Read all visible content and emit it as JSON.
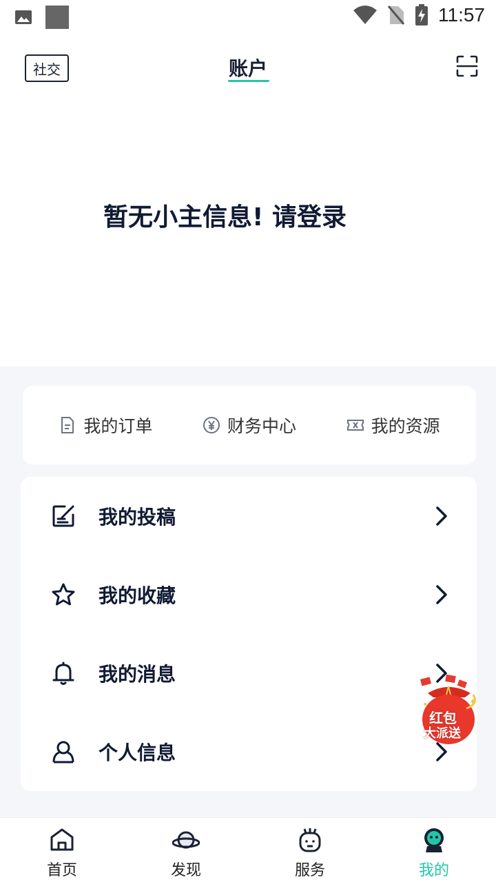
{
  "status_bar": {
    "time": "11:57"
  },
  "header": {
    "social_label": "社交",
    "title": "账户",
    "login_prompt": "暂无小主信息! 请登录"
  },
  "quick_links": [
    {
      "label": "我的订单",
      "icon": "document-icon"
    },
    {
      "label": "财务中心",
      "icon": "yen-coin-icon"
    },
    {
      "label": "我的资源",
      "icon": "ticket-icon"
    }
  ],
  "menu": [
    {
      "label": "我的投稿",
      "icon": "edit-icon"
    },
    {
      "label": "我的收藏",
      "icon": "star-icon"
    },
    {
      "label": "我的消息",
      "icon": "bell-icon"
    },
    {
      "label": "个人信息",
      "icon": "user-icon"
    }
  ],
  "promo": {
    "line1": "红包",
    "line2": "大派送"
  },
  "tabs": [
    {
      "label": "首页",
      "icon": "home-icon"
    },
    {
      "label": "发现",
      "icon": "planet-icon"
    },
    {
      "label": "服务",
      "icon": "robot-icon"
    },
    {
      "label": "我的",
      "icon": "profile-icon",
      "active": true
    }
  ],
  "colors": {
    "accent": "#21c7a8",
    "text_dark": "#101a33",
    "background": "#f5f6fa"
  }
}
